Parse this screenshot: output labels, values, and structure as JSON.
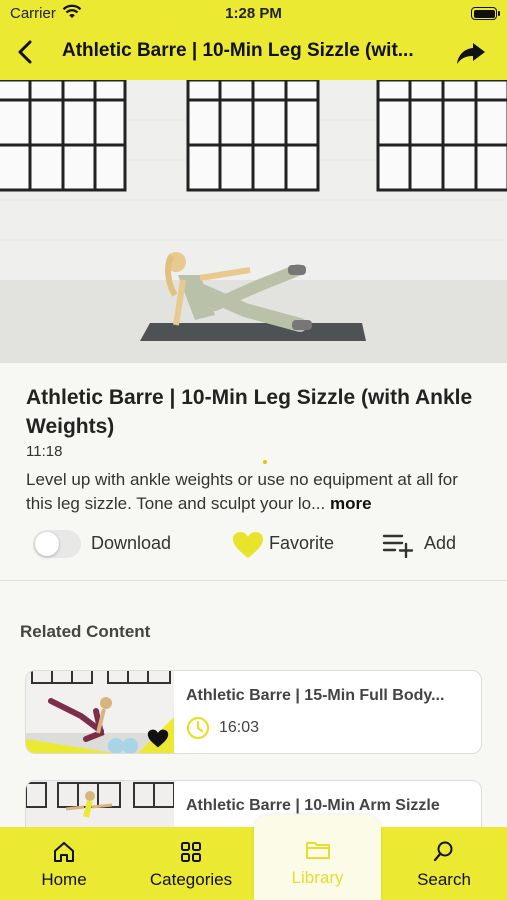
{
  "status_bar": {
    "carrier": "Carrier",
    "time": "1:28 PM"
  },
  "nav": {
    "title": "Athletic Barre | 10-Min Leg Sizzle (wit..."
  },
  "video": {
    "title": "Athletic Barre | 10-Min Leg Sizzle (with Ankle Weights)",
    "duration": "11:18",
    "description": "Level up with ankle weights or use no equipment at all for this leg sizzle. Tone and sculpt your lo...",
    "more_label": "more"
  },
  "actions": {
    "download_label": "Download",
    "download_on": false,
    "favorite_label": "Favorite",
    "add_label": "Add"
  },
  "related": {
    "heading": "Related Content",
    "items": [
      {
        "title": "Athletic Barre | 15-Min Full Body...",
        "duration": "16:03"
      },
      {
        "title": "Athletic Barre | 10-Min Arm Sizzle",
        "duration": ""
      }
    ]
  },
  "tabs": [
    {
      "label": "Home",
      "icon": "home-icon",
      "active": false
    },
    {
      "label": "Categories",
      "icon": "grid-icon",
      "active": false
    },
    {
      "label": "Library",
      "icon": "folder-icon",
      "active": true
    },
    {
      "label": "Search",
      "icon": "search-icon",
      "active": false
    }
  ],
  "colors": {
    "accent": "#ece932",
    "favorite": "#e8e42c",
    "active_tab_text": "#e6de2e"
  }
}
